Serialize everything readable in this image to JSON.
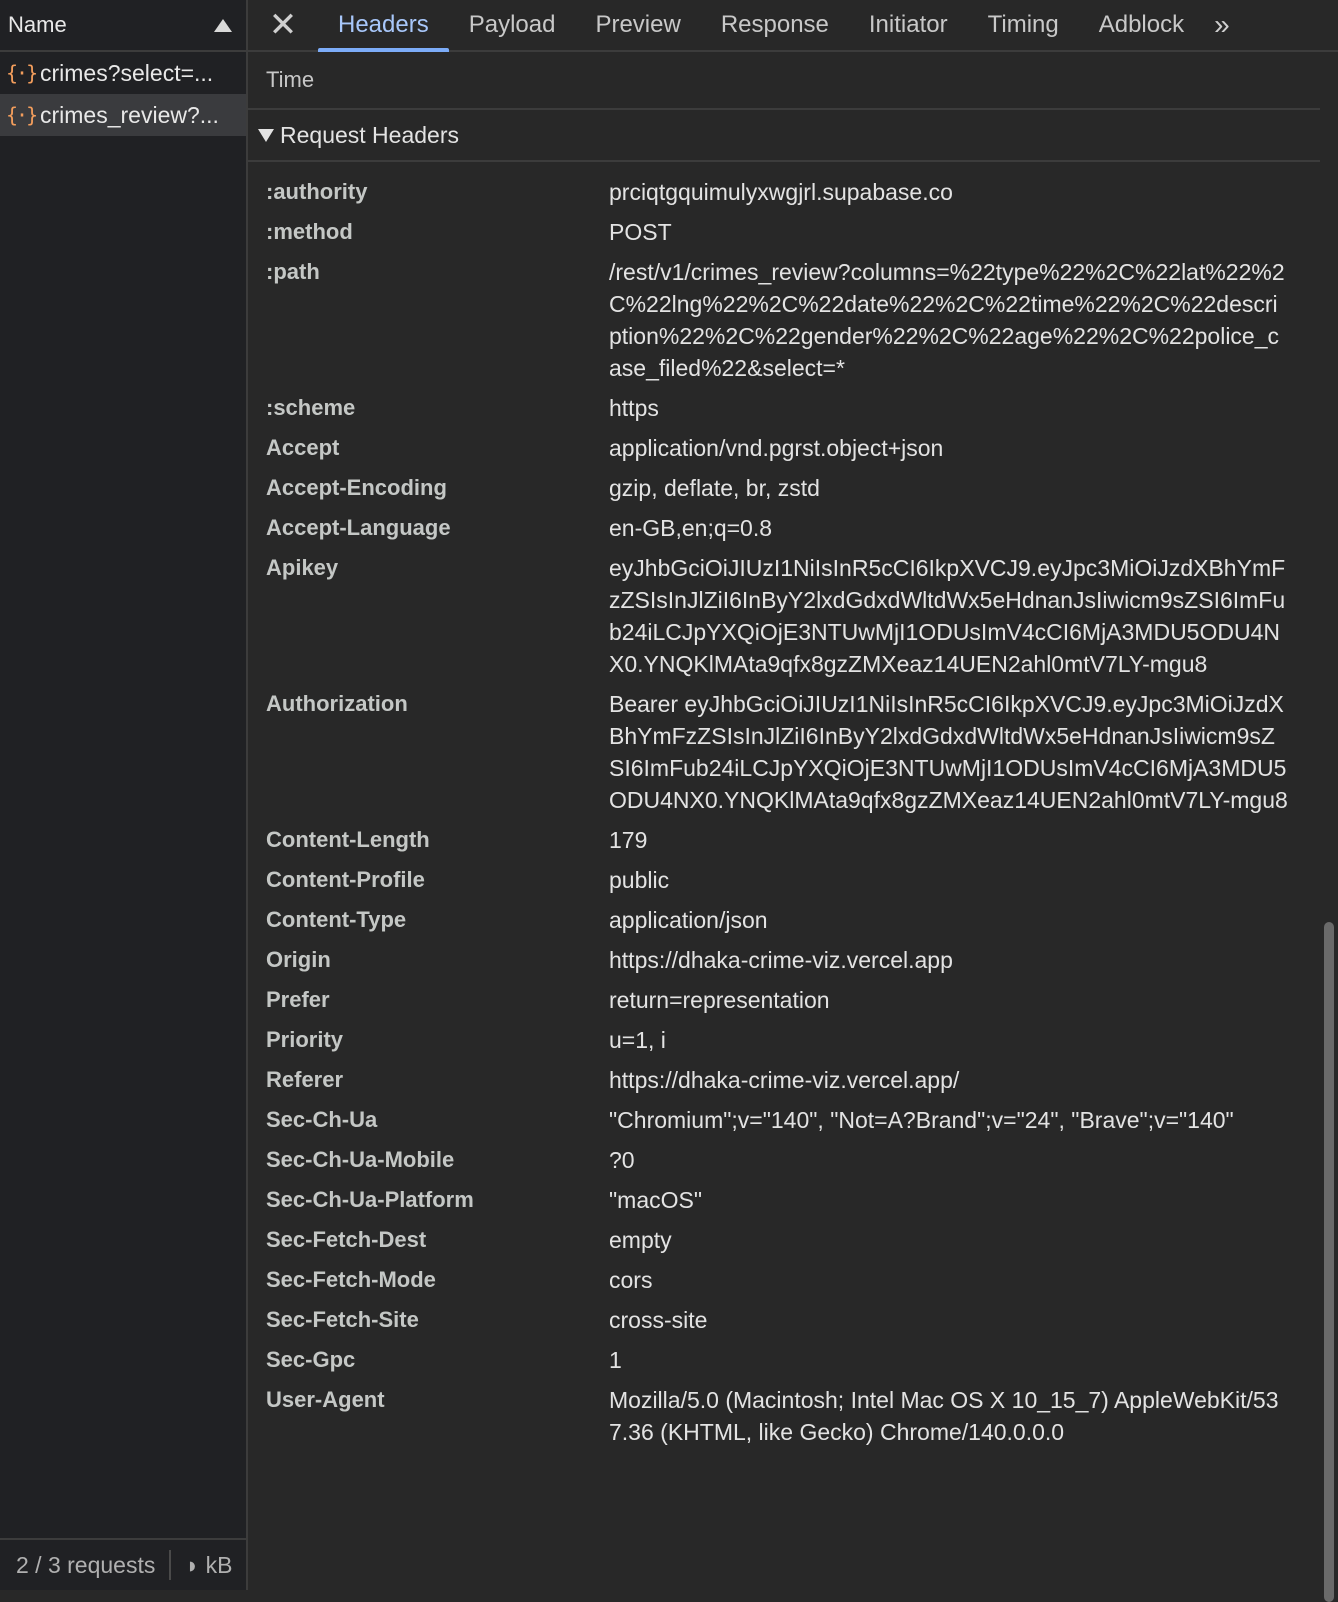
{
  "requests_panel": {
    "column_name": "Name",
    "items": [
      {
        "icon": "{·}",
        "label": "crimes?select=...",
        "selected": false
      },
      {
        "icon": "{·}",
        "label": "crimes_review?...",
        "selected": true
      }
    ],
    "status": {
      "count": "2 / 3 requests",
      "size": "◗ kB"
    }
  },
  "tabs": [
    "Headers",
    "Payload",
    "Preview",
    "Response",
    "Initiator",
    "Timing",
    "Adblock"
  ],
  "active_tab": "Headers",
  "detail": {
    "prev_row_label": "Time",
    "section_title": "Request Headers",
    "headers": [
      {
        "name": ":authority",
        "value": "prciqtgquimulyxwgjrl.supabase.co"
      },
      {
        "name": ":method",
        "value": "POST"
      },
      {
        "name": ":path",
        "value": "/rest/v1/crimes_review?columns=%22type%22%2C%22lat%22%2C%22lng%22%2C%22date%22%2C%22time%22%2C%22description%22%2C%22gender%22%2C%22age%22%2C%22police_case_filed%22&select=*"
      },
      {
        "name": ":scheme",
        "value": "https"
      },
      {
        "name": "Accept",
        "value": "application/vnd.pgrst.object+json"
      },
      {
        "name": "Accept-Encoding",
        "value": "gzip, deflate, br, zstd"
      },
      {
        "name": "Accept-Language",
        "value": "en-GB,en;q=0.8"
      },
      {
        "name": "Apikey",
        "value": "eyJhbGciOiJIUzI1NiIsInR5cCI6IkpXVCJ9.eyJpc3MiOiJzdXBhYmFzZSIsInJlZiI6InByY2lxdGdxdWltdWx5eHdnanJsIiwicm9sZSI6ImFub24iLCJpYXQiOjE3NTUwMjI1ODUsImV4cCI6MjA3MDU5ODU4NX0.YNQKlMAta9qfx8gzZMXeaz14UEN2ahl0mtV7LY-mgu8"
      },
      {
        "name": "Authorization",
        "value": "Bearer eyJhbGciOiJIUzI1NiIsInR5cCI6IkpXVCJ9.eyJpc3MiOiJzdXBhYmFzZSIsInJlZiI6InByY2lxdGdxdWltdWx5eHdnanJsIiwicm9sZSI6ImFub24iLCJpYXQiOjE3NTUwMjI1ODUsImV4cCI6MjA3MDU5ODU4NX0.YNQKlMAta9qfx8gzZMXeaz14UEN2ahl0mtV7LY-mgu8"
      },
      {
        "name": "Content-Length",
        "value": "179"
      },
      {
        "name": "Content-Profile",
        "value": "public"
      },
      {
        "name": "Content-Type",
        "value": "application/json"
      },
      {
        "name": "Origin",
        "value": "https://dhaka-crime-viz.vercel.app"
      },
      {
        "name": "Prefer",
        "value": "return=representation"
      },
      {
        "name": "Priority",
        "value": "u=1, i"
      },
      {
        "name": "Referer",
        "value": "https://dhaka-crime-viz.vercel.app/"
      },
      {
        "name": "Sec-Ch-Ua",
        "value": "\"Chromium\";v=\"140\", \"Not=A?Brand\";v=\"24\", \"Brave\";v=\"140\""
      },
      {
        "name": "Sec-Ch-Ua-Mobile",
        "value": "?0"
      },
      {
        "name": "Sec-Ch-Ua-Platform",
        "value": "\"macOS\""
      },
      {
        "name": "Sec-Fetch-Dest",
        "value": "empty"
      },
      {
        "name": "Sec-Fetch-Mode",
        "value": "cors"
      },
      {
        "name": "Sec-Fetch-Site",
        "value": "cross-site"
      },
      {
        "name": "Sec-Gpc",
        "value": "1"
      },
      {
        "name": "User-Agent",
        "value": "Mozilla/5.0 (Macintosh; Intel Mac OS X 10_15_7) AppleWebKit/537.36 (KHTML, like Gecko) Chrome/140.0.0.0"
      }
    ]
  },
  "colors": {
    "accent": "#a8c7fa",
    "tab_underline": "#7cacf8",
    "json_icon": "#f29d5c",
    "background": "#282828"
  }
}
